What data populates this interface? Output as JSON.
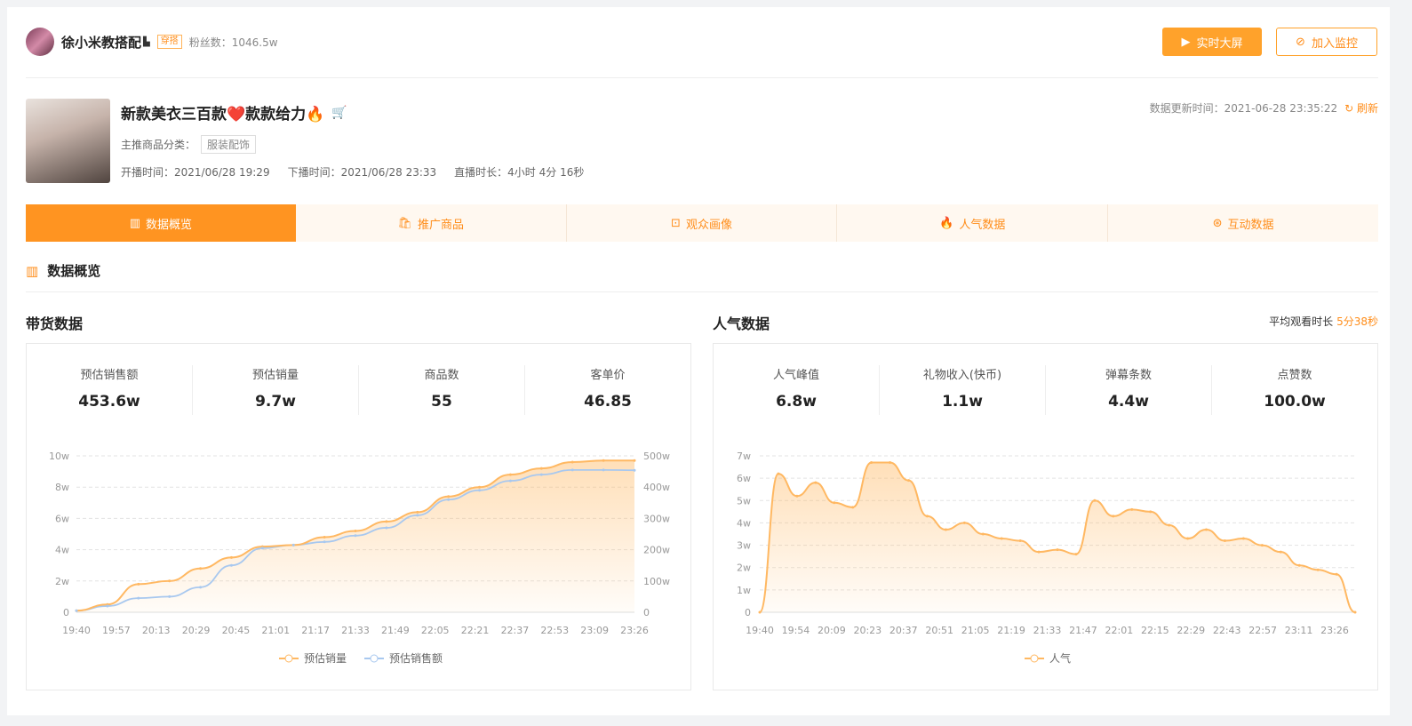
{
  "anchor": {
    "name": "徐小米教搭配",
    "category_tag": "穿搭",
    "fans_label": "粉丝数：",
    "fans": "1046.5w"
  },
  "actions": {
    "big_screen": "实时大屏",
    "monitor": "加入监控"
  },
  "live": {
    "title": "新款美衣三百款❤️款款给力🔥",
    "category_label": "主推商品分类：",
    "category": "服装配饰",
    "start_label": "开播时间：",
    "start": "2021/06/28 19:29",
    "end_label": "下播时间：",
    "end": "2021/06/28 23:33",
    "duration_label": "直播时长：",
    "duration": "4小时 4分 16秒",
    "update_label": "数据更新时间：",
    "update_time": "2021-06-28 23:35:22",
    "refresh": "刷新"
  },
  "tabs": [
    {
      "label": "数据概览",
      "icon": "bar-chart-icon",
      "glyph": "▥"
    },
    {
      "label": "推广商品",
      "icon": "basket-icon",
      "glyph": "🛍"
    },
    {
      "label": "观众画像",
      "icon": "face-scan-icon",
      "glyph": "⊡"
    },
    {
      "label": "人气数据",
      "icon": "flame-icon",
      "glyph": "🔥"
    },
    {
      "label": "互动数据",
      "icon": "pulse-icon",
      "glyph": "⊛"
    }
  ],
  "section_title": "数据概览",
  "sales": {
    "title": "带货数据",
    "stats": [
      {
        "label": "预估销售额",
        "value": "453.6w"
      },
      {
        "label": "预估销量",
        "value": "9.7w"
      },
      {
        "label": "商品数",
        "value": "55"
      },
      {
        "label": "客单价",
        "value": "46.85"
      }
    ]
  },
  "popularity": {
    "title": "人气数据",
    "avg_label": "平均观看时长",
    "avg_value": "5分38秒",
    "stats": [
      {
        "label": "人气峰值",
        "value": "6.8w"
      },
      {
        "label": "礼物收入(快币)",
        "value": "1.1w"
      },
      {
        "label": "弹幕条数",
        "value": "4.4w"
      },
      {
        "label": "点赞数",
        "value": "100.0w"
      }
    ]
  },
  "chart_data": [
    {
      "type": "line",
      "x_ticks": [
        "19:40",
        "19:57",
        "20:13",
        "20:29",
        "20:45",
        "21:01",
        "21:17",
        "21:33",
        "21:49",
        "22:05",
        "22:21",
        "22:37",
        "22:53",
        "23:09",
        "23:26"
      ],
      "y_left_ticks": [
        "0",
        "2w",
        "4w",
        "6w",
        "8w",
        "10w"
      ],
      "y_right_ticks": [
        "0",
        "100w",
        "200w",
        "300w",
        "400w",
        "500w"
      ],
      "ylim_left": [
        0,
        10
      ],
      "ylim_right": [
        0,
        500
      ],
      "colors": {
        "volume": "#ffb862",
        "amount": "#a8c8ef"
      },
      "series": [
        {
          "name": "预估销量",
          "axis": "left",
          "values": [
            0.1,
            0.5,
            1.8,
            2.0,
            2.8,
            3.5,
            4.2,
            4.3,
            4.8,
            5.2,
            5.8,
            6.4,
            7.4,
            8.0,
            8.8,
            9.2,
            9.6,
            9.7,
            9.7
          ]
        },
        {
          "name": "预估销售额",
          "axis": "right",
          "values": [
            5,
            20,
            45,
            50,
            80,
            150,
            205,
            215,
            225,
            245,
            270,
            310,
            360,
            390,
            420,
            440,
            455,
            455,
            454
          ]
        }
      ],
      "legend": [
        "预估销量",
        "预估销售额"
      ]
    },
    {
      "type": "area",
      "x_ticks": [
        "19:40",
        "19:54",
        "20:09",
        "20:23",
        "20:37",
        "20:51",
        "21:05",
        "21:19",
        "21:33",
        "21:47",
        "22:01",
        "22:15",
        "22:29",
        "22:43",
        "22:57",
        "23:11",
        "23:26"
      ],
      "y_ticks": [
        "0",
        "1w",
        "2w",
        "3w",
        "4w",
        "5w",
        "6w",
        "7w"
      ],
      "ylim": [
        0,
        7
      ],
      "color": "#ffb862",
      "series": [
        {
          "name": "人气",
          "values": [
            0,
            6.2,
            5.2,
            5.8,
            4.9,
            4.7,
            6.7,
            6.7,
            5.9,
            4.3,
            3.7,
            4.0,
            3.5,
            3.3,
            3.2,
            2.7,
            2.8,
            2.6,
            5.0,
            4.3,
            4.6,
            4.5,
            3.9,
            3.3,
            3.7,
            3.2,
            3.3,
            3.0,
            2.7,
            2.1,
            1.9,
            1.7,
            0
          ]
        }
      ],
      "legend": [
        "人气"
      ]
    }
  ]
}
